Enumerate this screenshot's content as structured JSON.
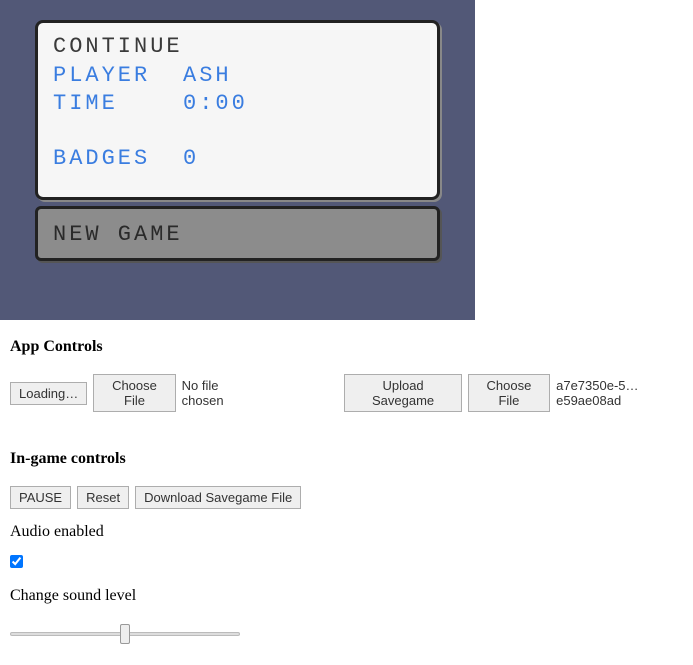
{
  "game": {
    "continue": {
      "title": "CONTINUE",
      "stats": [
        {
          "label": "PLAYER",
          "value": "ASH"
        },
        {
          "label": "TIME",
          "value": "0:00"
        }
      ],
      "stats_after_gap": [
        {
          "label": "BADGES",
          "value": "0"
        }
      ]
    },
    "new_game_label": "NEW GAME"
  },
  "app_controls": {
    "title": "App Controls",
    "loading_button": "Loading…",
    "choose_file_1": "Choose File",
    "no_file_chosen": "No file chosen",
    "upload_savegame": "Upload Savegame",
    "choose_file_2": "Choose File",
    "savegame_filename": "a7e7350e-5…e59ae08ad"
  },
  "ingame_controls": {
    "title": "In-game controls",
    "pause": "PAUSE",
    "reset": "Reset",
    "download": "Download Savegame File",
    "audio_label": "Audio enabled",
    "audio_checked": true,
    "sound_label": "Change sound level",
    "sound_value": 50,
    "sound_min": 0,
    "sound_max": 100
  }
}
